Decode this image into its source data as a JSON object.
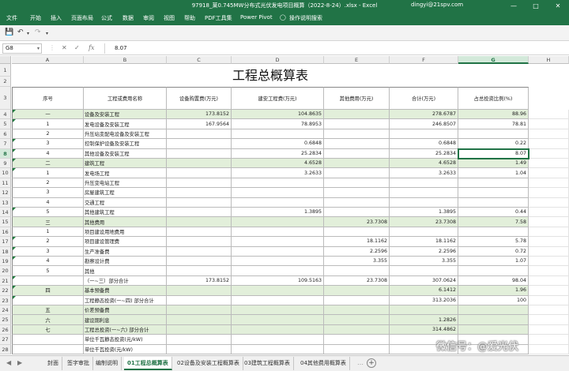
{
  "window": {
    "title": "97918_莱0.745MW分布式光伏发电项目概算（2022-8-24）.xlsx  -  Excel",
    "user": "dingyi@21spv.com"
  },
  "ribbon_tabs": [
    "文件",
    "开始",
    "插入",
    "页面布局",
    "公式",
    "数据",
    "审阅",
    "视图",
    "帮助",
    "PDF工具集",
    "Power Pivot",
    "操作说明搜索"
  ],
  "formula_bar": {
    "name_box": "G8",
    "value": "8.07"
  },
  "columns": [
    "A",
    "B",
    "C",
    "D",
    "E",
    "F",
    "G",
    "H"
  ],
  "sheet_title": "工程总概算表",
  "headers": [
    "序号",
    "工程或费用名称",
    "设备购置费(万元)",
    "建安工程费(万元)",
    "其他费用(万元)",
    "合计(万元)",
    "占总投资比例(%)"
  ],
  "rows": [
    {
      "n": "4",
      "a": "一",
      "b": "设备及安装工程",
      "c": "173.8152",
      "d": "104.8635",
      "e": "",
      "f": "278.6787",
      "g": "88.96",
      "hl": true
    },
    {
      "n": "5",
      "a": "1",
      "b": "发电设备及安装工程",
      "c": "167.9564",
      "d": "78.8953",
      "e": "",
      "f": "246.8507",
      "g": "78.81"
    },
    {
      "n": "6",
      "a": "2",
      "b": "升压站变配电设备及安装工程",
      "c": "",
      "d": "",
      "e": "",
      "f": "",
      "g": ""
    },
    {
      "n": "7",
      "a": "3",
      "b": "控制保护设备及安装工程",
      "c": "",
      "d": "0.6848",
      "e": "",
      "f": "0.6848",
      "g": "0.22"
    },
    {
      "n": "8",
      "a": "4",
      "b": "其他设备及安装工程",
      "c": "",
      "d": "25.2834",
      "e": "",
      "f": "25.2834",
      "g": "8.07"
    },
    {
      "n": "9",
      "a": "二",
      "b": "建筑工程",
      "c": "",
      "d": "4.6528",
      "e": "",
      "f": "4.6528",
      "g": "1.49",
      "hl": true
    },
    {
      "n": "10",
      "a": "1",
      "b": "发电场工程",
      "c": "",
      "d": "3.2633",
      "e": "",
      "f": "3.2633",
      "g": "1.04"
    },
    {
      "n": "11",
      "a": "2",
      "b": "升压变电站工程",
      "c": "",
      "d": "",
      "e": "",
      "f": "",
      "g": ""
    },
    {
      "n": "12",
      "a": "3",
      "b": "房屋建筑工程",
      "c": "",
      "d": "",
      "e": "",
      "f": "",
      "g": ""
    },
    {
      "n": "13",
      "a": "4",
      "b": "交通工程",
      "c": "",
      "d": "",
      "e": "",
      "f": "",
      "g": ""
    },
    {
      "n": "14",
      "a": "5",
      "b": "其他建筑工程",
      "c": "",
      "d": "1.3895",
      "e": "",
      "f": "1.3895",
      "g": "0.44"
    },
    {
      "n": "15",
      "a": "三",
      "b": "其他费用",
      "c": "",
      "d": "",
      "e": "23.7308",
      "f": "23.7308",
      "g": "7.58",
      "hl": true
    },
    {
      "n": "16",
      "a": "1",
      "b": "项目建设用地费用",
      "c": "",
      "d": "",
      "e": "",
      "f": "",
      "g": ""
    },
    {
      "n": "17",
      "a": "2",
      "b": "项目建设管理费",
      "c": "",
      "d": "",
      "e": "18.1162",
      "f": "18.1162",
      "g": "5.78"
    },
    {
      "n": "18",
      "a": "3",
      "b": "生产准备费",
      "c": "",
      "d": "",
      "e": "2.2596",
      "f": "2.2596",
      "g": "0.72"
    },
    {
      "n": "19",
      "a": "4",
      "b": "勘察设计费",
      "c": "",
      "d": "",
      "e": "3.355",
      "f": "3.355",
      "g": "1.07"
    },
    {
      "n": "20",
      "a": "5",
      "b": "其他",
      "c": "",
      "d": "",
      "e": "",
      "f": "",
      "g": ""
    },
    {
      "n": "21",
      "a": "",
      "b": "（一~三）部分合计",
      "c": "173.8152",
      "d": "109.5163",
      "e": "23.7308",
      "f": "307.0624",
      "g": "98.04"
    },
    {
      "n": "22",
      "a": "四",
      "b": "基本预备费",
      "c": "",
      "d": "",
      "e": "",
      "f": "6.1412",
      "g": "1.96",
      "hl": true
    },
    {
      "n": "23",
      "a": "",
      "b": "工程静态投资(一~四) 部分合计",
      "c": "",
      "d": "",
      "e": "",
      "f": "313.2036",
      "g": "100"
    },
    {
      "n": "24",
      "a": "五",
      "b": "价差预备费",
      "c": "",
      "d": "",
      "e": "",
      "f": "",
      "g": "",
      "hl": true
    },
    {
      "n": "25",
      "a": "六",
      "b": "建设期利息",
      "c": "",
      "d": "",
      "e": "",
      "f": "1.2826",
      "g": "",
      "hl": true
    },
    {
      "n": "26",
      "a": "七",
      "b": "工程总投资(一~六) 部分合计",
      "c": "",
      "d": "",
      "e": "",
      "f": "314.4862",
      "g": "",
      "hl": true
    },
    {
      "n": "27",
      "a": "",
      "b": "单位千瓦静态投资(元/kW)",
      "c": "",
      "d": "",
      "e": "",
      "f": "",
      "g": ""
    },
    {
      "n": "28",
      "a": "",
      "b": "单位千瓦投资(元/kW)",
      "c": "",
      "d": "",
      "e": "",
      "f": "",
      "g": ""
    }
  ],
  "sheet_tabs": [
    "封面",
    "签字审批",
    "编制说明",
    "01工程总概算表",
    "02设备及安装工程概算表",
    "03建筑工程概算表",
    "04其他费用概算表"
  ],
  "active_sheet": "01工程总概算表",
  "watermark": "微信号：@爱光伏",
  "colors": {
    "accent": "#217346",
    "highlight_row": "#e2efda"
  }
}
